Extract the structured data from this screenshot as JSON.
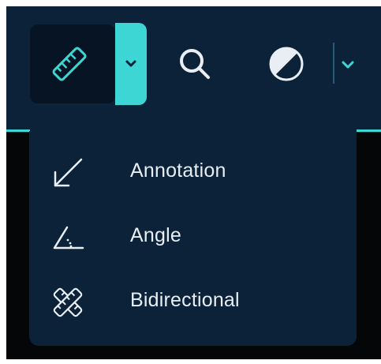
{
  "toolbar": {
    "measure_tool_icon": "ruler-icon",
    "dropdown_icon": "chevron-down-icon",
    "zoom_tool_icon": "search-icon",
    "contrast_tool_icon": "contrast-icon",
    "contrast_dropdown_icon": "chevron-down-icon"
  },
  "measure_menu": {
    "items": [
      {
        "label": "Annotation",
        "icon": "arrow-annotation-icon"
      },
      {
        "label": "Angle",
        "icon": "angle-icon"
      },
      {
        "label": "Bidirectional",
        "icon": "bidirectional-icon"
      }
    ]
  },
  "colors": {
    "toolbar_bg": "#0b2239",
    "active_button_bg": "#061423",
    "accent": "#3ed6d4",
    "icon": "#e8eef4",
    "viewport_bg": "#040608"
  }
}
